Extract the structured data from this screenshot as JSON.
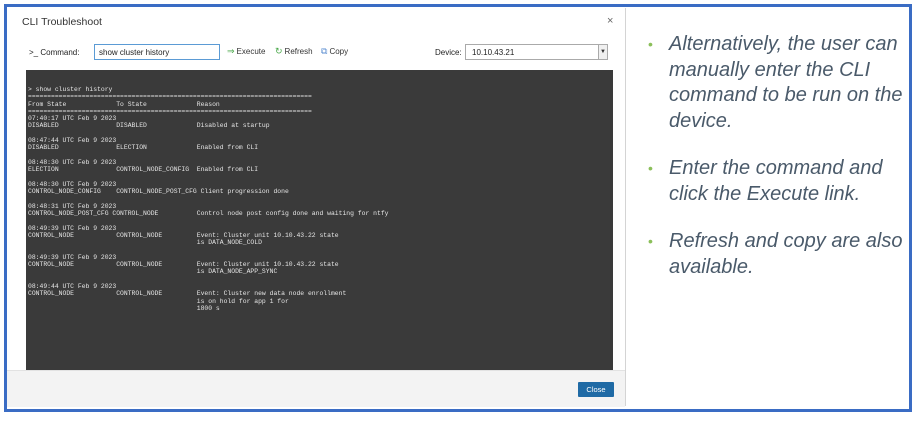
{
  "dialog": {
    "title": "CLI Troubleshoot",
    "close_glyph": "×",
    "toolbar": {
      "prompt_label": ">_ Command:",
      "command_value": "show cluster history",
      "execute_label": "Execute",
      "refresh_label": "Refresh",
      "copy_label": "Copy",
      "device_label": "Device:",
      "device_value": "10.10.43.21"
    },
    "terminal_output": "> show cluster history\n==========================================================================\nFrom State             To State             Reason\n==========================================================================\n07:40:17 UTC Feb 9 2023\nDISABLED               DISABLED             Disabled at startup\n\n08:47:44 UTC Feb 9 2023\nDISABLED               ELECTION             Enabled from CLI\n\n08:48:30 UTC Feb 9 2023\nELECTION               CONTROL_NODE_CONFIG  Enabled from CLI\n\n08:48:30 UTC Feb 9 2023\nCONTROL_NODE_CONFIG    CONTROL_NODE_POST_CFG Client progression done\n\n08:48:31 UTC Feb 9 2023\nCONTROL_NODE_POST_CFG CONTROL_NODE          Control node post config done and waiting for ntfy\n\n08:49:39 UTC Feb 9 2023\nCONTROL_NODE           CONTROL_NODE         Event: Cluster unit 10.10.43.22 state\n                                            is DATA_NODE_COLD\n\n08:49:39 UTC Feb 9 2023\nCONTROL_NODE           CONTROL_NODE         Event: Cluster unit 10.10.43.22 state\n                                            is DATA_NODE_APP_SYNC\n\n08:49:44 UTC Feb 9 2023\nCONTROL_NODE           CONTROL_NODE         Event: Cluster new data node enrollment\n                                            is on hold for app 1 for\n                                            1800 s",
    "close_button_label": "Close",
    "accent_color": "#1f6aa5"
  },
  "icons": {
    "execute": "arrow-right-icon",
    "refresh": "refresh-icon",
    "copy": "copy-icon",
    "device_dropdown": "chevron-down-icon"
  },
  "notes": [
    "Alternatively, the user can manually enter the CLI command to be run on the device.",
    "Enter the command and click the Execute link.",
    "Refresh and copy are also available."
  ],
  "frame_color": "#3a6cc4",
  "bullet_color": "#8bbf5a"
}
